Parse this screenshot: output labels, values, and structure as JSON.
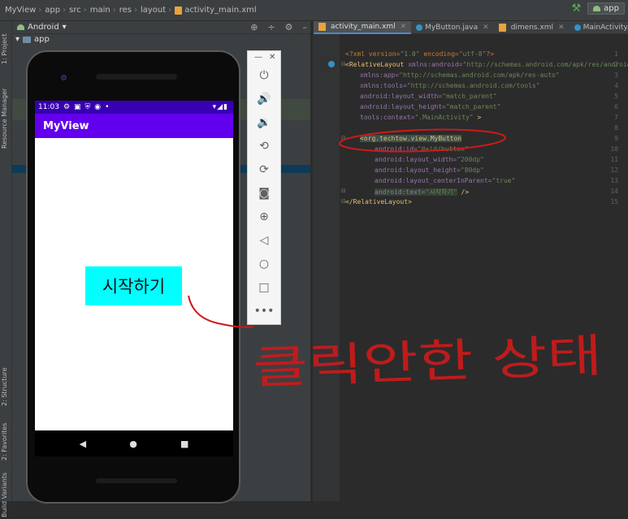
{
  "topbar": {
    "crumbs": [
      "MyView",
      "app",
      "src",
      "main",
      "res",
      "layout",
      "activity_main.xml"
    ],
    "run_config": "app"
  },
  "left_strip": {
    "tabs": [
      "1: Project",
      "Resource Manager",
      "2: Structure",
      "2: Favorites",
      "Build Variants"
    ]
  },
  "project": {
    "view_mode": "Android",
    "root": "app"
  },
  "emulator": {
    "status_time": "11:03",
    "app_title": "MyView",
    "button_text": "시작하기",
    "tools": [
      "power-icon",
      "volume-up-icon",
      "volume-down-icon",
      "rotate-left-icon",
      "rotate-right-icon",
      "camera-icon",
      "zoom-icon",
      "back-icon",
      "home-icon",
      "overview-icon",
      "more-icon"
    ]
  },
  "editor": {
    "tabs": [
      {
        "label": "activity_main.xml",
        "active": true
      },
      {
        "label": "MyButton.java",
        "active": false
      },
      {
        "label": "dimens.xml",
        "active": false
      },
      {
        "label": "MainActivity.java",
        "active": false
      }
    ],
    "line_numbers": [
      "1",
      "2",
      "3",
      "4",
      "5",
      "6",
      "7",
      "8",
      "9",
      "10",
      "11",
      "12",
      "13",
      "14",
      "15"
    ],
    "code": {
      "l1_a": "<?xml version=",
      "l1_b": "\"1.0\"",
      "l1_c": " encoding=",
      "l1_d": "\"utf-8\"",
      "l1_e": "?>",
      "l2_tag": "<RelativeLayout ",
      "l2_attr": "xmlns:android=",
      "l2_val": "\"http://schemas.android.com/apk/res/android\"",
      "l3_attr": "xmlns:app=",
      "l3_val": "\"http://schemas.android.com/apk/res-auto\"",
      "l4_attr": "xmlns:tools=",
      "l4_val": "\"http://schemas.android.com/tools\"",
      "l5_attr": "android:layout_width=",
      "l5_val": "\"match_parent\"",
      "l6_attr": "android:layout_height=",
      "l6_val": "\"match_parent\"",
      "l7_attr": "tools:context=",
      "l7_val": "\".MainActivity\"",
      "l7_end": " >",
      "l9_tag": "<org.techtow.view.MyButton",
      "l10_attr": "android:id=",
      "l10_val": "\"@+id/button\"",
      "l11_attr": "android:layout_width=",
      "l11_val": "\"200dp\"",
      "l12_attr": "android:layout_height=",
      "l12_val": "\"80dp\"",
      "l13_attr": "android:layout_centerInParent=",
      "l13_val": "\"true\"",
      "l14_attr": "android:text=",
      "l14_val": "\"시작하기\"",
      "l14_end": " />",
      "l15_tag": "</RelativeLayout>"
    }
  },
  "annotation": {
    "text": "클릭안한 상태",
    "color": "#cc1a1a"
  }
}
